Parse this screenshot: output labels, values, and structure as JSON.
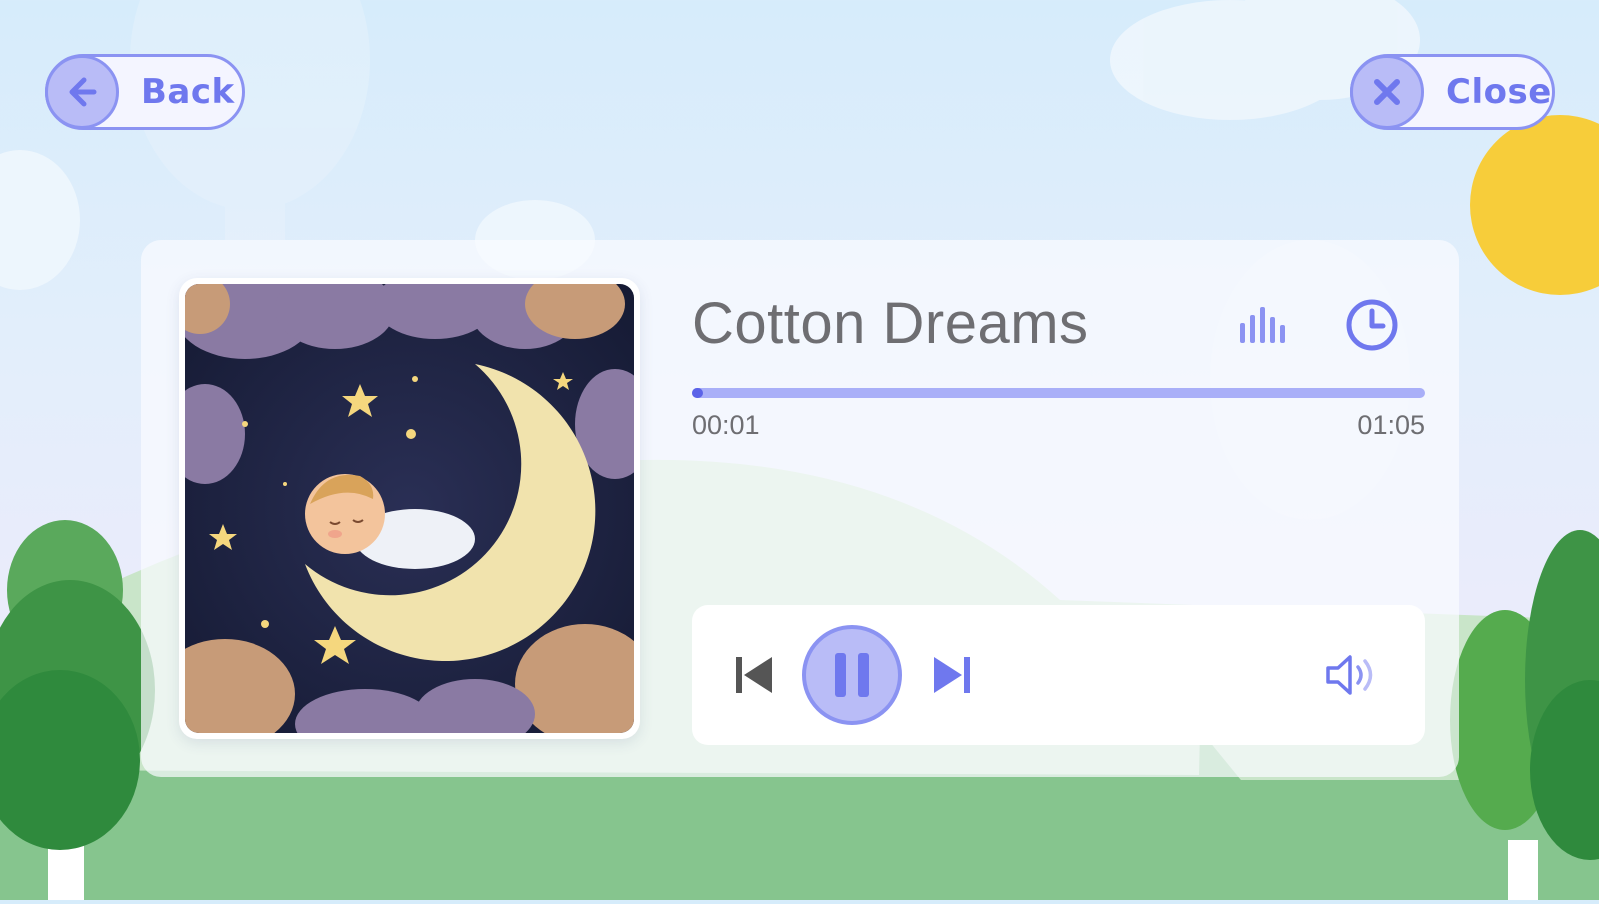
{
  "header": {
    "back_label": "Back",
    "close_label": "Close"
  },
  "player": {
    "title": "Cotton Dreams",
    "elapsed": "00:01",
    "duration": "01:05",
    "progress_fraction": 0.015,
    "state": "playing"
  },
  "icons": {
    "back": "arrow-left-icon",
    "close": "x-icon",
    "equalizer": "equalizer-icon",
    "timer": "clock-icon",
    "previous": "skip-previous-icon",
    "pause": "pause-icon",
    "next": "skip-next-icon",
    "volume": "volume-icon"
  },
  "colors": {
    "accent": "#8b93f2",
    "accent_dark": "#5b63e8",
    "text": "#6e6e72"
  }
}
